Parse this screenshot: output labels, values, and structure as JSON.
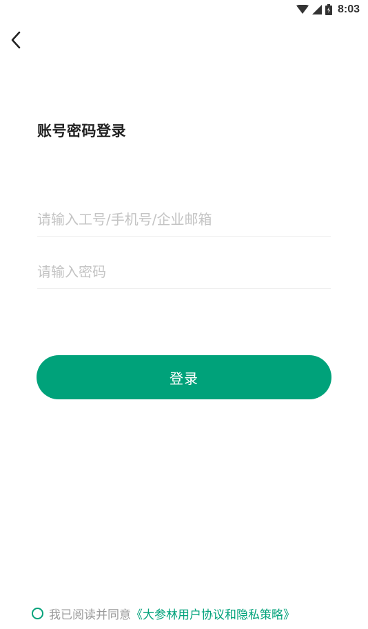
{
  "status_bar": {
    "time": "8:03",
    "icons": [
      "wifi-icon",
      "cell-signal-icon",
      "battery-icon"
    ]
  },
  "nav": {
    "back_icon": "chevron-left-icon"
  },
  "title": "账号密码登录",
  "form": {
    "account_placeholder": "请输入工号/手机号/企业邮箱",
    "account_value": "",
    "password_placeholder": "请输入密码",
    "password_value": ""
  },
  "login_button_label": "登录",
  "agreement": {
    "checked": false,
    "text": "我已阅读并同意",
    "link": "《大参林用户协议和隐私策略》"
  },
  "colors": {
    "accent": "#00a27a",
    "placeholder": "#c4c4c4",
    "divider": "#eeeeee",
    "muted_text": "#9a9a9a"
  }
}
